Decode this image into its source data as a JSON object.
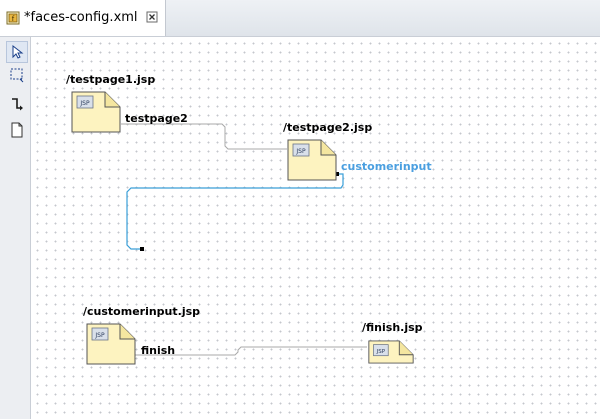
{
  "tab": {
    "title": "*faces-config.xml",
    "icon": "faces-config-icon",
    "close_icon": "close-icon"
  },
  "palette": {
    "tools": [
      {
        "name": "select-tool-icon",
        "selected": true
      },
      {
        "name": "marquee-tool-icon",
        "selected": false
      },
      {
        "name": "link-tool-icon",
        "selected": false
      },
      {
        "name": "page-tool-icon",
        "selected": false
      }
    ]
  },
  "diagram": {
    "pages": [
      {
        "label": "/testpage1.jsp"
      },
      {
        "label": "/testpage2.jsp"
      },
      {
        "label": "/customerinput.jsp"
      },
      {
        "label": "/finish.jsp"
      }
    ],
    "navigation_cases": [
      {
        "label": "testpage2",
        "selected": false
      },
      {
        "label": "customerinput",
        "selected": true
      },
      {
        "label": "finish",
        "selected": false
      }
    ],
    "colors": {
      "page_fill": "#fdf3c0",
      "wire": "#a8a8a8",
      "selected_wire": "#3a9fd8",
      "selected_label": "#4a9fe0"
    }
  }
}
